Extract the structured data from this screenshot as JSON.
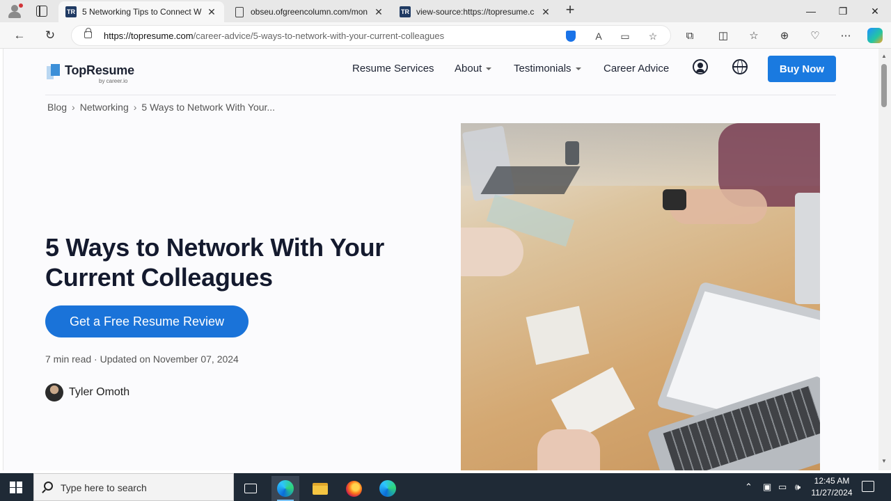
{
  "browser": {
    "tabs": [
      {
        "title": "5 Networking Tips to Connect Wi",
        "favicon": "TR",
        "active": true
      },
      {
        "title": "obseu.ofgreencolumn.com/mon",
        "favicon": "doc",
        "active": false
      },
      {
        "title": "view-source:https://topresume.c",
        "favicon": "TR",
        "active": false
      }
    ],
    "url_domain": "https://topresume.com",
    "url_path": "/career-advice/5-ways-to-network-with-your-current-colleagues"
  },
  "site": {
    "logo_name": "TopResume",
    "logo_sub": "by career.io",
    "nav": {
      "resume_services": "Resume Services",
      "about": "About",
      "testimonials": "Testimonials",
      "career_advice": "Career Advice",
      "buy_now": "Buy Now"
    }
  },
  "breadcrumb": {
    "blog": "Blog",
    "networking": "Networking",
    "current": "5 Ways to Network With Your..."
  },
  "article": {
    "title": "5 Ways to Network With Your Current Colleagues",
    "cta": "Get a Free Resume Review",
    "meta": "7 min read · Updated on November 07, 2024",
    "author": "Tyler Omoth"
  },
  "taskbar": {
    "search_placeholder": "Type here to search",
    "time": "12:45 AM",
    "date": "11/27/2024"
  },
  "colors": {
    "accent": "#1a7ae0",
    "heading": "#141a2e"
  }
}
